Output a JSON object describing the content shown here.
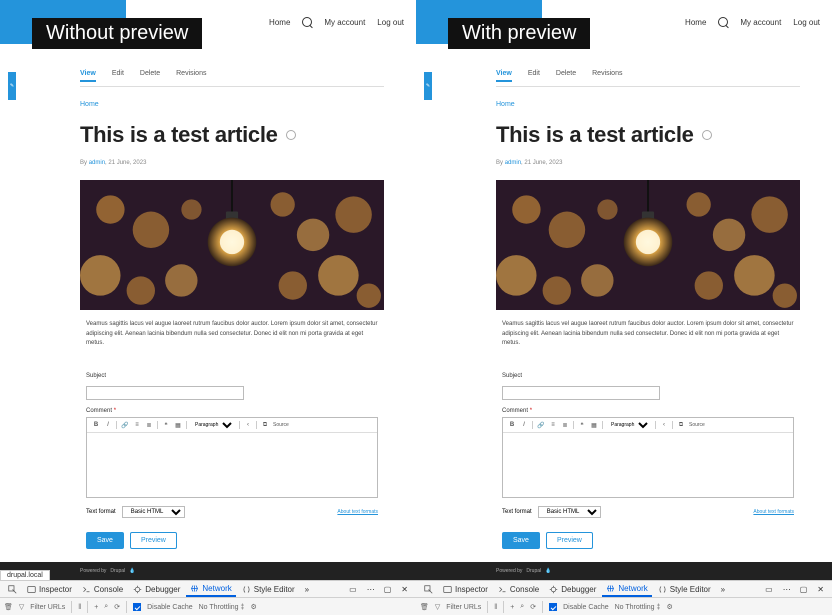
{
  "badges": {
    "left": "Without preview",
    "right": "With preview"
  },
  "topbar": {
    "home": "Home",
    "account": "My account",
    "logout": "Log out"
  },
  "tabs": {
    "view": "View",
    "edit": "Edit",
    "delete": "Delete",
    "revisions": "Revisions"
  },
  "breadcrumb": "Home",
  "article": {
    "title": "This is a test article",
    "by": "By",
    "author": "admin",
    "date": "21 June, 2023",
    "body": "Veamus sagittis lacus vel augue laoreet rutrum faucibus dolor auctor. Lorem ipsum dolor sit amet, consectetur adipiscing elit. Aenean lacinia bibendum nulla sed consectetur. Donec id elit non mi porta gravida at eget metus."
  },
  "form": {
    "subject_label": "Subject",
    "comment_label": "Comment",
    "required": "*",
    "rte": {
      "bold": "B",
      "italic": "I",
      "paragraph": "Paragraph",
      "source": "Source"
    },
    "format_label": "Text format",
    "format_value": "Basic HTML",
    "format_help": "About text formats",
    "save": "Save",
    "preview": "Preview"
  },
  "footer": {
    "powered": "Powered by",
    "drupal": "Drupal"
  },
  "devtools": {
    "url": "drupal.local",
    "inspector": "Inspector",
    "console": "Console",
    "debugger": "Debugger",
    "network": "Network",
    "style": "Style Editor",
    "more": "»",
    "filter": "Filter URLs",
    "disable_cache": "Disable Cache",
    "throttling": "No Throttling",
    "throttling_arrow": "‡"
  }
}
